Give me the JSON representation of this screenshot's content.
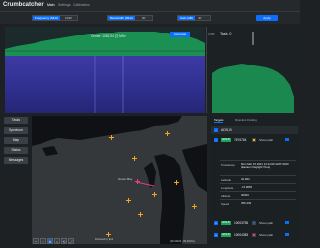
{
  "app": {
    "title": "Crumbcatcher"
  },
  "nav": {
    "items": [
      "Main",
      "Settings",
      "Calibration"
    ],
    "active": "Main"
  },
  "controls": {
    "frequency": {
      "label": "Frequency (MHz)",
      "value": "1090"
    },
    "bandwidth": {
      "label": "Bandwidth (MHz)",
      "value": "90"
    },
    "gain": {
      "label": "Gain (dB)",
      "value": "40"
    },
    "apply_label": "Apply"
  },
  "spectrum": {
    "center_label": "Center: 1082.94 [?] MHz",
    "autoscale_label": "Autoscale",
    "task_title": "Task: 0",
    "task_side_label": "0.095"
  },
  "sidebar": {
    "buttons": [
      "Tasks",
      "Spectrum",
      "Map",
      "Status",
      "Messages"
    ]
  },
  "map": {
    "credit": "Powered by Esri",
    "coords": "(29.34118, -89.40231)",
    "toolbar": [
      "+",
      "−",
      "⊕",
      "⌂",
      "⟲",
      "⤢"
    ],
    "places": [
      "Green Bay"
    ]
  },
  "panel": {
    "tabs": [
      "Targets",
      "Direction Finding"
    ],
    "active_tab": "Targets",
    "group_title": "ADS-B",
    "aircraft": [
      {
        "badge": "ADS-B",
        "hex": "7676764",
        "show_path": "Show path",
        "path_color": "#f0c000"
      },
      {
        "badge": "ADS-B",
        "hex": "10003755",
        "show_path": "Show path",
        "path_color": "#1f5db8"
      },
      {
        "badge": "ADS-B",
        "hex": "10004383",
        "show_path": "Show path",
        "path_color": "#e23b8f"
      }
    ],
    "details": {
      "timestamp": {
        "key": "Timestamp",
        "value": "Mon Mar 15 2021 14:14:09 GMT-0400 (Eastern Daylight Time)"
      },
      "latitude": {
        "key": "Latitude",
        "value": "42.994"
      },
      "longitude": {
        "key": "Longitude",
        "value": "-74.9656"
      },
      "altitude": {
        "key": "Altitude",
        "value": "30000"
      },
      "speed": {
        "key": "Speed",
        "value": "356.439"
      }
    }
  },
  "colors": {
    "accent": "#0d6efd",
    "adsb_badge": "#19a45a",
    "fft_trace": "#21c06a",
    "waterfall": "#3a3aa8",
    "map_land": "#35383b",
    "map_water": "#0f1114"
  }
}
